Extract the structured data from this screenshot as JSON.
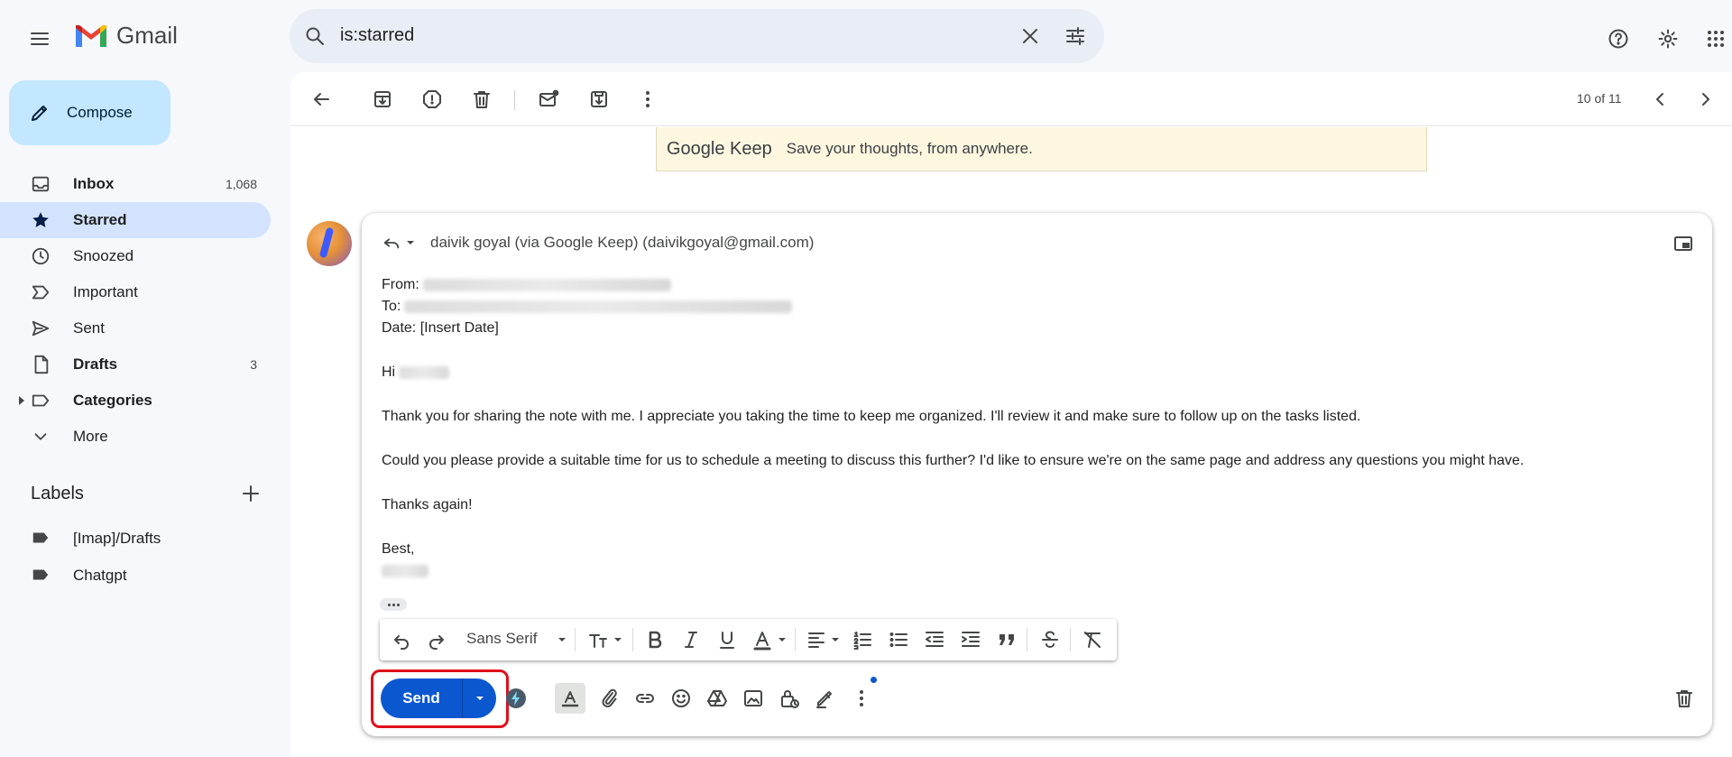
{
  "app": {
    "name": "Gmail"
  },
  "search": {
    "query": "is:starred"
  },
  "compose": {
    "label": "Compose"
  },
  "nav": {
    "inbox": {
      "label": "Inbox",
      "count": "1,068"
    },
    "starred": {
      "label": "Starred"
    },
    "snoozed": {
      "label": "Snoozed"
    },
    "important": {
      "label": "Important"
    },
    "sent": {
      "label": "Sent"
    },
    "drafts": {
      "label": "Drafts",
      "count": "3"
    },
    "categories": {
      "label": "Categories"
    },
    "more": {
      "label": "More"
    }
  },
  "labels": {
    "title": "Labels",
    "items": [
      "[Imap]/Drafts",
      "Chatgpt"
    ]
  },
  "toolbar": {
    "pager": "10 of 11"
  },
  "banner": {
    "brand": "Google Keep",
    "tagline": "Save your thoughts, from anywhere."
  },
  "reply": {
    "recipient": "daivik goyal (via Google Keep) (daivikgoyal@gmail.com)",
    "from_label": "From:",
    "to_label": "To:",
    "date_line": "Date: [Insert Date]",
    "greeting": "Hi",
    "para1": "Thank you for sharing the note with me. I appreciate you taking the time to keep me organized. I'll review it and make sure to follow up on the tasks listed.",
    "para2": "Could you please provide a suitable time for us to schedule a meeting to discuss this further? I'd like to ensure we're on the same page and address any questions you might have.",
    "thanks": "Thanks again!",
    "closing": "Best,"
  },
  "format": {
    "font": "Sans Serif"
  },
  "send": {
    "label": "Send"
  },
  "colors": {
    "accent": "#0b57d0",
    "active_nav": "#d3e3fd",
    "compose_bg": "#c2e7ff",
    "highlight": "#e0101a"
  }
}
